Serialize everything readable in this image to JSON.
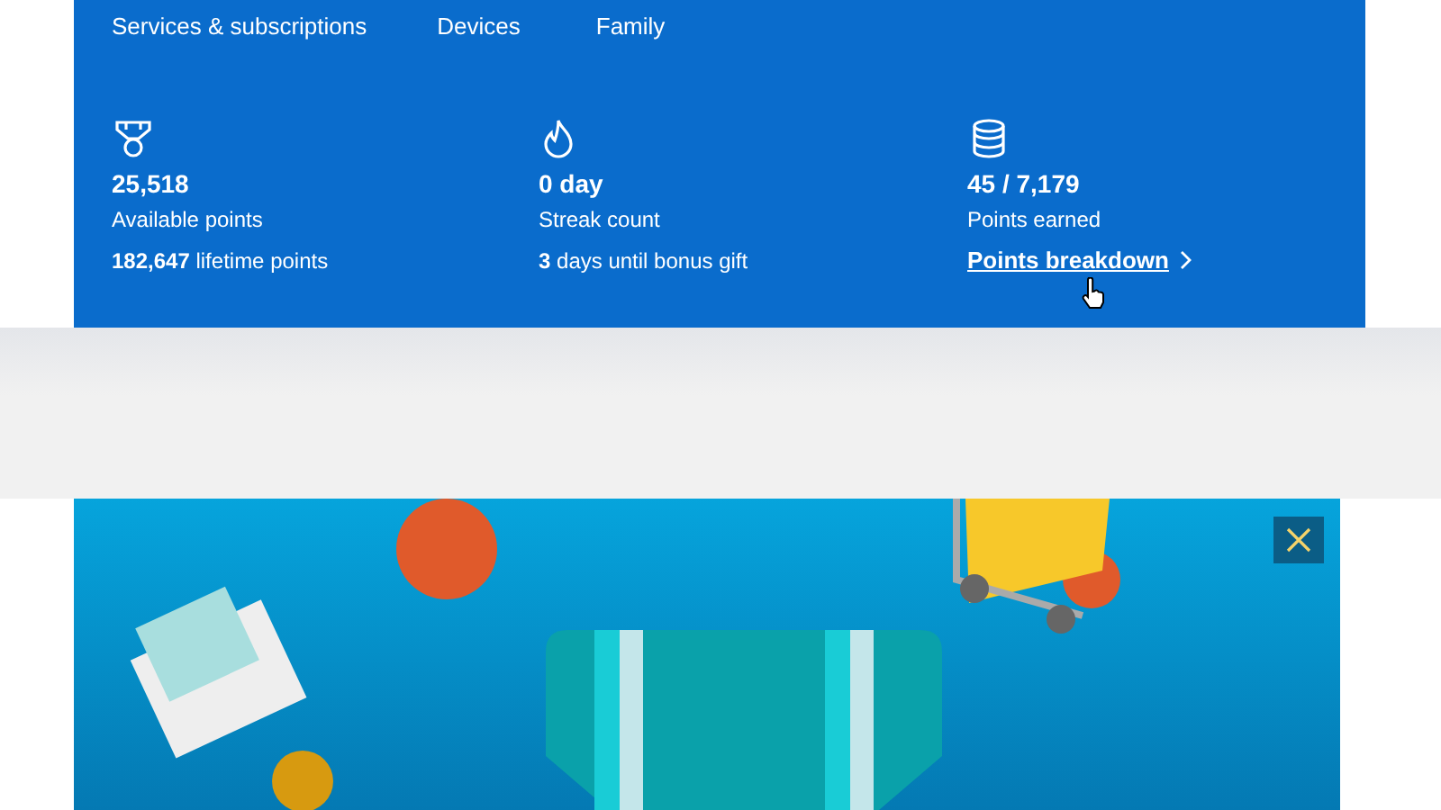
{
  "nav": [
    {
      "label": "Services & subscriptions"
    },
    {
      "label": "Devices"
    },
    {
      "label": "Family"
    }
  ],
  "stats": [
    {
      "kind": "medal",
      "value": "25,518",
      "label": "Available points",
      "detail": "**182,647** lifetime points"
    },
    {
      "kind": "flame",
      "value": "0 day",
      "label": "Streak count",
      "detail": "**3** days until bonus gift"
    },
    {
      "kind": "coins",
      "value": "45 / 7,179",
      "label": "Points earned",
      "link": "Points breakdown"
    }
  ]
}
